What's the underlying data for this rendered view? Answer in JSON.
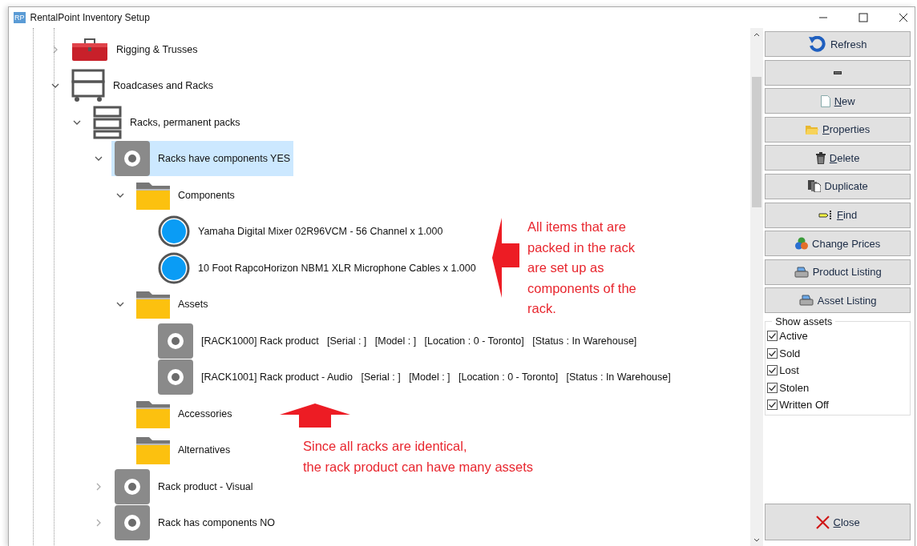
{
  "window": {
    "app_icon_text": "RP",
    "title": "RentalPoint Inventory Setup"
  },
  "tree": [
    {
      "label": "Rigging & Trusses",
      "kind": "toolbox",
      "expanded": false,
      "selected": false
    },
    {
      "label": "Roadcases and Racks",
      "kind": "cart",
      "expanded": true,
      "selected": false,
      "children": [
        {
          "label": "Racks, permanent packs",
          "kind": "rack",
          "expanded": true,
          "selected": false,
          "children": [
            {
              "label": "Racks have components YES",
              "kind": "disc",
              "expanded": true,
              "selected": true,
              "children": [
                {
                  "label": "Components",
                  "kind": "folder",
                  "expanded": true,
                  "selected": false,
                  "children": [
                    {
                      "label": "Yamaha Digital Mixer 02R96VCM - 56 Channel x 1.000",
                      "kind": "ball",
                      "selected": false
                    },
                    {
                      "label": "10 Foot RapcoHorizon NBM1 XLR Microphone Cables x 1.000",
                      "kind": "ball",
                      "selected": false
                    }
                  ]
                },
                {
                  "label": "Assets",
                  "kind": "folder",
                  "expanded": true,
                  "selected": false,
                  "children": [
                    {
                      "label": "[RACK1000] Rack product   [Serial : ]   [Model : ]   [Location : 0 - Toronto]   [Status : In Warehouse]",
                      "kind": "disc",
                      "selected": false
                    },
                    {
                      "label": "[RACK1001] Rack product - Audio   [Serial : ]   [Model : ]   [Location : 0 - Toronto]   [Status : In Warehouse]",
                      "kind": "disc",
                      "selected": false
                    }
                  ]
                },
                {
                  "label": "Accessories",
                  "kind": "folder",
                  "selected": false
                },
                {
                  "label": "Alternatives",
                  "kind": "folder",
                  "selected": false
                }
              ]
            },
            {
              "label": "Rack product - Visual",
              "kind": "disc",
              "expanded": false,
              "selected": false
            },
            {
              "label": "Rack has components NO",
              "kind": "disc",
              "expanded": false,
              "selected": false
            }
          ]
        }
      ]
    }
  ],
  "annotations": [
    {
      "kind": "arrow-left",
      "text": "All items that are\npacked in the rack\nare set up as\ncomponents of the\nrack."
    },
    {
      "kind": "arrow-up",
      "text": "Since all racks are identical,\nthe rack product can have many assets"
    }
  ],
  "buttons": [
    {
      "kind": "refresh",
      "label": "Refresh",
      "underline_first": false
    },
    {
      "kind": "dash"
    },
    {
      "kind": "new",
      "label": "New",
      "underline_first": true
    },
    {
      "kind": "properties",
      "label": "Properties",
      "underline_first": true
    },
    {
      "kind": "delete",
      "label": "Delete",
      "underline_first": true
    },
    {
      "kind": "duplicate",
      "label": "Duplicate",
      "underline_first": false
    },
    {
      "kind": "find",
      "label": "Find",
      "underline_first": true
    },
    {
      "kind": "prices",
      "label": "Change Prices",
      "underline_first": false
    },
    {
      "kind": "print",
      "label": "Product Listing",
      "underline_first": false
    },
    {
      "kind": "print",
      "label": "Asset Listing",
      "underline_first": false
    }
  ],
  "show_assets": {
    "title": "Show assets",
    "options": [
      {
        "label": "Active",
        "checked": true
      },
      {
        "label": "Sold",
        "checked": true
      },
      {
        "label": "Lost",
        "checked": true
      },
      {
        "label": "Stolen",
        "checked": true
      },
      {
        "label": "Written Off",
        "checked": true
      }
    ]
  },
  "close_button": {
    "label": "Close",
    "underline_first": true
  }
}
